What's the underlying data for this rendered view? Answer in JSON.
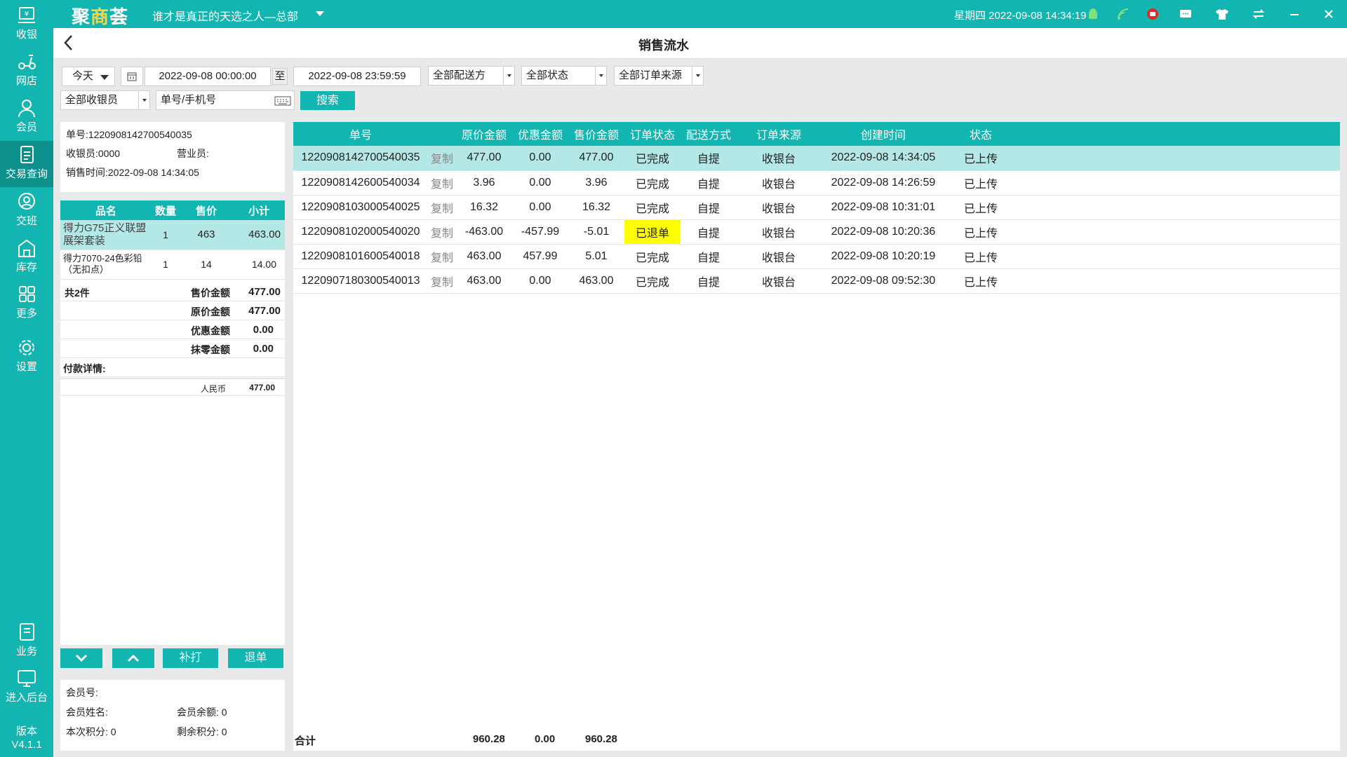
{
  "app": {
    "logo": [
      "聚",
      "商",
      "荟"
    ],
    "store_name": "谁才是真正的天选之人—总部",
    "datetime": "星期四 2022-09-08 14:34:19",
    "version_label": "版本",
    "version": "V4.1.1"
  },
  "sidebar": {
    "items": [
      {
        "label": "收银",
        "icon": "cashier-icon"
      },
      {
        "label": "网店",
        "icon": "scooter-icon"
      },
      {
        "label": "会员",
        "icon": "member-icon"
      },
      {
        "label": "交易查询",
        "icon": "document-icon"
      },
      {
        "label": "交班",
        "icon": "shift-icon"
      },
      {
        "label": "库存",
        "icon": "warehouse-icon"
      },
      {
        "label": "更多",
        "icon": "grid-icon"
      },
      {
        "label": "设置",
        "icon": "gear-icon"
      },
      {
        "label": "业务",
        "icon": "book-icon"
      },
      {
        "label": "进入后台",
        "icon": "monitor-icon"
      }
    ]
  },
  "page": {
    "title": "销售流水"
  },
  "filters": {
    "period": "今天",
    "start": "2022-09-08 00:00:00",
    "to": "至",
    "end": "2022-09-08 23:59:59",
    "delivery": "全部配送方",
    "status": "全部状态",
    "source": "全部订单来源",
    "cashier": "全部收银员",
    "search_placeholder": "单号/手机号",
    "search_button": "搜索"
  },
  "detail": {
    "order_no": "单号:1220908142700540035",
    "cashier": "收银员:0000",
    "clerk": "营业员:",
    "sale_time": "销售时间:2022-09-08 14:34:05",
    "headers": [
      "品名",
      "数量",
      "售价",
      "小计"
    ],
    "items": [
      {
        "name": "得力G75正义联盟展架套装",
        "qty": "1",
        "price": "463",
        "subtotal": "463.00"
      },
      {
        "name": "得力7070-24色彩铅（无扣点）",
        "qty": "1",
        "price": "14",
        "subtotal": "14.00"
      }
    ],
    "count": "共2件",
    "sale_amount_label": "售价金额",
    "sale_amount": "477.00",
    "orig_amount_label": "原价金额",
    "orig_amount": "477.00",
    "discount_label": "优惠金额",
    "discount": "0.00",
    "rounding_label": "抹零金额",
    "rounding": "0.00",
    "payment_label": "付款详情:",
    "payment_method": "人民币",
    "payment_amount": "477.00",
    "buttons": {
      "reprint": "补打",
      "refund": "退单"
    },
    "member_no": "会员号:",
    "member_name": "会员姓名:",
    "member_balance": "会员余额: 0",
    "points_this": "本次积分: 0",
    "points_left": "剩余积分: 0"
  },
  "orders": {
    "headers": [
      "单号",
      "原价金额",
      "优惠金额",
      "售价金额",
      "订单状态",
      "配送方式",
      "订单来源",
      "创建时间",
      "状态"
    ],
    "copy_label": "复制",
    "rows": [
      {
        "no": "1220908142700540035",
        "orig": "477.00",
        "disc": "0.00",
        "sale": "477.00",
        "ostatus": "已完成",
        "delivery": "自提",
        "source": "收银台",
        "created": "2022-09-08 14:34:05",
        "status": "已上传"
      },
      {
        "no": "1220908142600540034",
        "orig": "3.96",
        "disc": "0.00",
        "sale": "3.96",
        "ostatus": "已完成",
        "delivery": "自提",
        "source": "收银台",
        "created": "2022-09-08 14:26:59",
        "status": "已上传"
      },
      {
        "no": "1220908103000540025",
        "orig": "16.32",
        "disc": "0.00",
        "sale": "16.32",
        "ostatus": "已完成",
        "delivery": "自提",
        "source": "收银台",
        "created": "2022-09-08 10:31:01",
        "status": "已上传"
      },
      {
        "no": "1220908102000540020",
        "orig": "-463.00",
        "disc": "-457.99",
        "sale": "-5.01",
        "ostatus": "已退单",
        "delivery": "自提",
        "source": "收银台",
        "created": "2022-09-08 10:20:36",
        "status": "已上传"
      },
      {
        "no": "1220908101600540018",
        "orig": "463.00",
        "disc": "457.99",
        "sale": "5.01",
        "ostatus": "已完成",
        "delivery": "自提",
        "source": "收银台",
        "created": "2022-09-08 10:20:19",
        "status": "已上传"
      },
      {
        "no": "1220907180300540013",
        "orig": "463.00",
        "disc": "0.00",
        "sale": "463.00",
        "ostatus": "已完成",
        "delivery": "自提",
        "source": "收银台",
        "created": "2022-09-08 09:52:30",
        "status": "已上传"
      }
    ],
    "total_label": "合计",
    "total_orig": "960.28",
    "total_disc": "0.00",
    "total_sale": "960.28"
  },
  "colors": {
    "accent": "#13b5b1",
    "selected_row": "#b3e8e6",
    "refund_highlight": "#ffff00"
  }
}
